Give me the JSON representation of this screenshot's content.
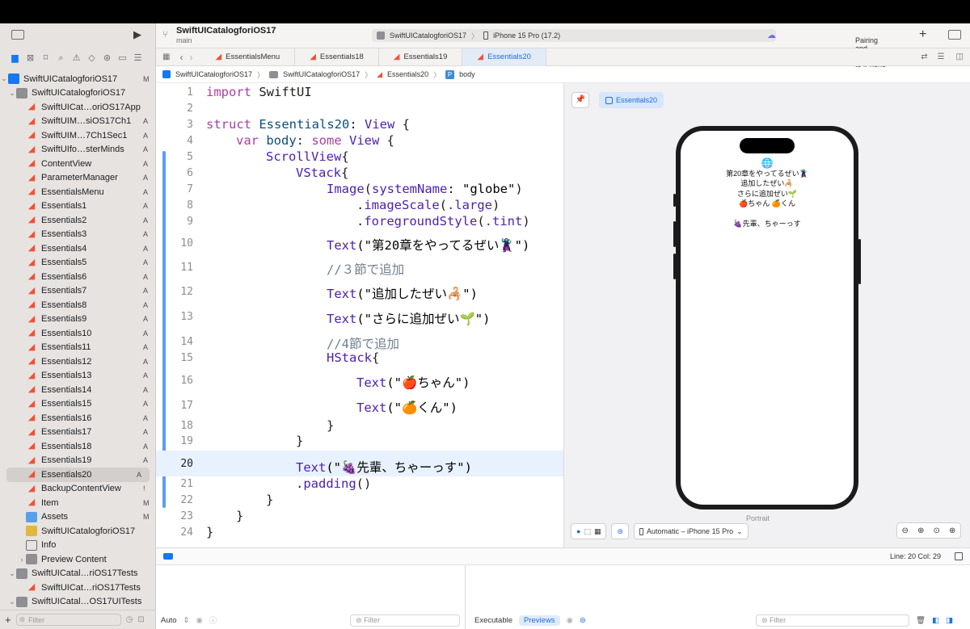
{
  "toolbar": {
    "project_title": "SwiftUICatalogforiOS17",
    "branch": "main",
    "scheme_project": "SwiftUICatalogforiOS17",
    "scheme_device": "iPhone 15 Pro (17.2)",
    "status_text": "Pairing and connecting to iPhone"
  },
  "tabs": [
    {
      "label": "EssentialsMenu"
    },
    {
      "label": "Essentials18"
    },
    {
      "label": "Essentials19"
    },
    {
      "label": "Essentials20"
    }
  ],
  "breadcrumb": {
    "project": "SwiftUICatalogforiOS17",
    "folder": "SwiftUICatalogforiOS17",
    "file": "Essentials20",
    "symbol": "body"
  },
  "navigator": {
    "items": [
      {
        "label": "SwiftUICatalogforiOS17",
        "badge": "M"
      },
      {
        "label": "SwiftUICatalogforiOS17",
        "badge": ""
      },
      {
        "label": "SwiftUICat…oriOS17App",
        "badge": ""
      },
      {
        "label": "SwiftUIM…siOS17Ch1",
        "badge": "A"
      },
      {
        "label": "SwiftUIM…7Ch1Sec1",
        "badge": "A"
      },
      {
        "label": "SwiftUIfo…sterMinds",
        "badge": "A"
      },
      {
        "label": "ContentView",
        "badge": "A"
      },
      {
        "label": "ParameterManager",
        "badge": "A"
      },
      {
        "label": "EssentialsMenu",
        "badge": "A"
      },
      {
        "label": "Essentials1",
        "badge": "A"
      },
      {
        "label": "Essentials2",
        "badge": "A"
      },
      {
        "label": "Essentials3",
        "badge": "A"
      },
      {
        "label": "Essentials4",
        "badge": "A"
      },
      {
        "label": "Essentials5",
        "badge": "A"
      },
      {
        "label": "Essentials6",
        "badge": "A"
      },
      {
        "label": "Essentials7",
        "badge": "A"
      },
      {
        "label": "Essentials8",
        "badge": "A"
      },
      {
        "label": "Essentials9",
        "badge": "A"
      },
      {
        "label": "Essentials10",
        "badge": "A"
      },
      {
        "label": "Essentials11",
        "badge": "A"
      },
      {
        "label": "Essentials12",
        "badge": "A"
      },
      {
        "label": "Essentials13",
        "badge": "A"
      },
      {
        "label": "Essentials14",
        "badge": "A"
      },
      {
        "label": "Essentials15",
        "badge": "A"
      },
      {
        "label": "Essentials16",
        "badge": "A"
      },
      {
        "label": "Essentials17",
        "badge": "A"
      },
      {
        "label": "Essentials18",
        "badge": "A"
      },
      {
        "label": "Essentials19",
        "badge": "A"
      },
      {
        "label": "Essentials20",
        "badge": "A"
      },
      {
        "label": "BackupContentView",
        "badge": "!"
      },
      {
        "label": "Item",
        "badge": "M"
      },
      {
        "label": "Assets",
        "badge": "M"
      },
      {
        "label": "SwiftUICatalogforiOS17",
        "badge": ""
      },
      {
        "label": "Info",
        "badge": ""
      },
      {
        "label": "Preview Content",
        "badge": ""
      },
      {
        "label": "SwiftUICatal…riOS17Tests",
        "badge": ""
      },
      {
        "label": "SwiftUICat…riOS17Tests",
        "badge": ""
      },
      {
        "label": "SwiftUICatal…OS17UITests",
        "badge": ""
      }
    ],
    "filter_placeholder": "Filter"
  },
  "code": {
    "line_numbers": [
      "1",
      "2",
      "3",
      "4",
      "5",
      "6",
      "7",
      "8",
      "9",
      "10",
      "11",
      "12",
      "13",
      "14",
      "15",
      "16",
      "17",
      "18",
      "19",
      "20",
      "21",
      "22",
      "23",
      "24"
    ],
    "l1_kw": "import",
    "l1_rest": " SwiftUI",
    "l3_kw": "struct",
    "l3_name": " Essentials20",
    "l3_colon": ": ",
    "l3_type": "View",
    "l3_brace": " {",
    "l4_kw1": "var",
    "l4_name": " body",
    "l4_colon": ": ",
    "l4_kw2": "some",
    "l4_type": " View",
    "l4_brace": " {",
    "l5_type": "ScrollView",
    "l5_brace": "{",
    "l6_type": "VStack",
    "l6_brace": "{",
    "l7_type": "Image",
    "l7_open": "(",
    "l7_param": "systemName",
    "l7_colon": ": ",
    "l7_str": "\"globe\"",
    "l7_close": ")",
    "l8_dot": ".",
    "l8_fn": "imageScale",
    "l8_open": "(",
    "l8_arg": ".large",
    "l8_close": ")",
    "l9_dot": ".",
    "l9_fn": "foregroundStyle",
    "l9_open": "(",
    "l9_arg": ".tint",
    "l9_close": ")",
    "l10_type": "Text",
    "l10_str": "(\"第20章をやってるぜい🦹\")",
    "l11_comment": "//３節で追加",
    "l12_type": "Text",
    "l12_str": "(\"追加したぜい🦂\")",
    "l13_type": "Text",
    "l13_str": "(\"さらに追加ぜい🌱\")",
    "l14_comment": "//4節で追加",
    "l15_type": "HStack",
    "l15_brace": "{",
    "l16_type": "Text",
    "l16_str": "(\"🍎ちゃん\")",
    "l17_type": "Text",
    "l17_str": "(\"🍊くん\")",
    "l18_brace": "}",
    "l19_brace": "}",
    "l20_type": "Text",
    "l20_str": "(\"🍇先輩、ちゃーっす\")",
    "l21_dot": ".",
    "l21_fn": "padding",
    "l21_paren": "()",
    "l22_brace": "}",
    "l23_brace": "}",
    "l24_brace": "}"
  },
  "preview": {
    "tab_label": "Essentials20",
    "phone_text": {
      "line1": "第20章をやってるぜい🦹",
      "line2": "追加したぜい🦂",
      "line3": "さらに追加ぜい🌱",
      "line4a": "🍎ちゃん",
      "line4b": "🍊くん",
      "line5": "🍇先輩、ちゃーっす"
    },
    "orientation_label": "Portrait",
    "device_select": "Automatic – iPhone 15 Pro"
  },
  "statusbar": {
    "position": "Line: 20  Col: 29"
  },
  "debug": {
    "auto_label": "Auto",
    "filter_placeholder": "Filter",
    "executable_label": "Executable",
    "previews_label": "Previews",
    "filter2_placeholder": "Filter"
  },
  "colors": {
    "accent": "#1478f0",
    "keyword": "#ad3da4",
    "type": "#3d8b8f",
    "swift": "#f05138"
  }
}
